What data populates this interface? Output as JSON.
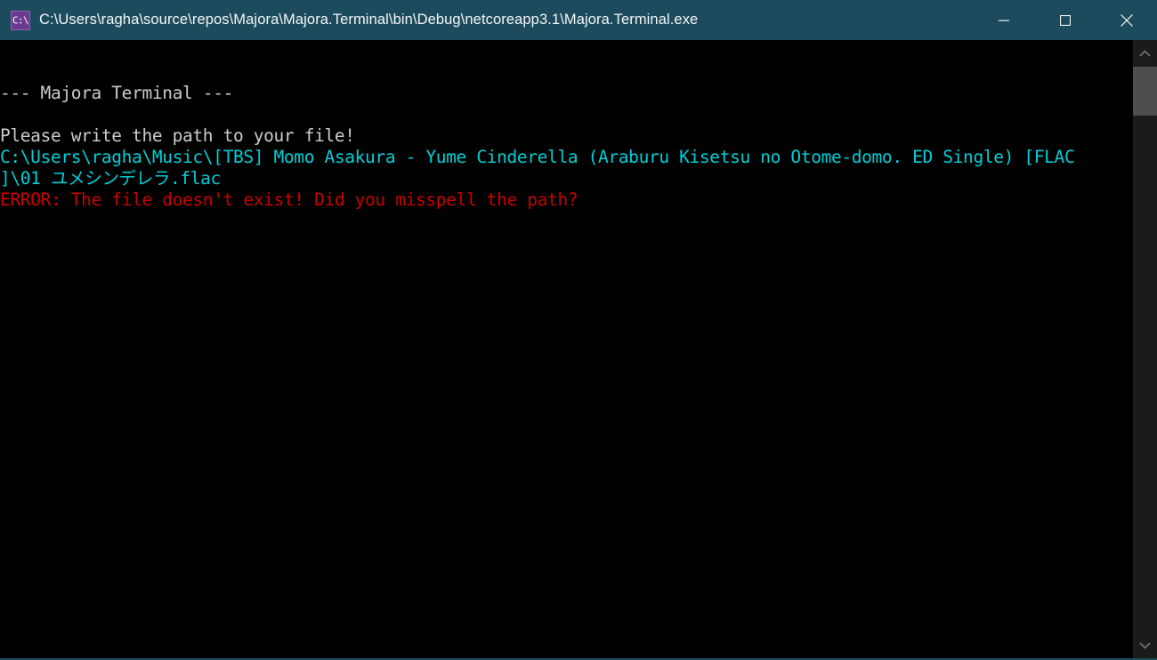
{
  "window": {
    "title": "C:\\Users\\ragha\\source\\repos\\Majora\\Majora.Terminal\\bin\\Debug\\netcoreapp3.1\\Majora.Terminal.exe",
    "icon_glyph": "C:\\",
    "titlebar_color": "#1d4b5e",
    "icon_color": "#6b3a8f"
  },
  "controls": {
    "minimize_label": "Minimize",
    "maximize_label": "Maximize",
    "close_label": "Close"
  },
  "console": {
    "background": "#000000",
    "colors": {
      "default": "#cccccc",
      "cyan": "#00cfd6",
      "red": "#cc0000"
    },
    "lines": [
      {
        "text": "--- Majora Terminal ---",
        "color": "default"
      },
      {
        "text": "",
        "color": "default"
      },
      {
        "text": "Please write the path to your file!",
        "color": "default"
      },
      {
        "text": "C:\\Users\\ragha\\Music\\[TBS] Momo Asakura - Yume Cinderella (Araburu Kisetsu no Otome-domo. ED Single) [FLAC",
        "color": "cyan"
      },
      {
        "text": "]\\01 ユメシンデレラ.flac",
        "color": "cyan"
      },
      {
        "text": "ERROR: The file doesn't exist! Did you misspell the path?",
        "color": "red"
      }
    ]
  },
  "scrollbar": {
    "up_label": "Scroll up",
    "down_label": "Scroll down",
    "thumb_label": "Scroll thumb",
    "track_color": "#1b1b1b",
    "thumb_color": "#4e4e4e"
  }
}
